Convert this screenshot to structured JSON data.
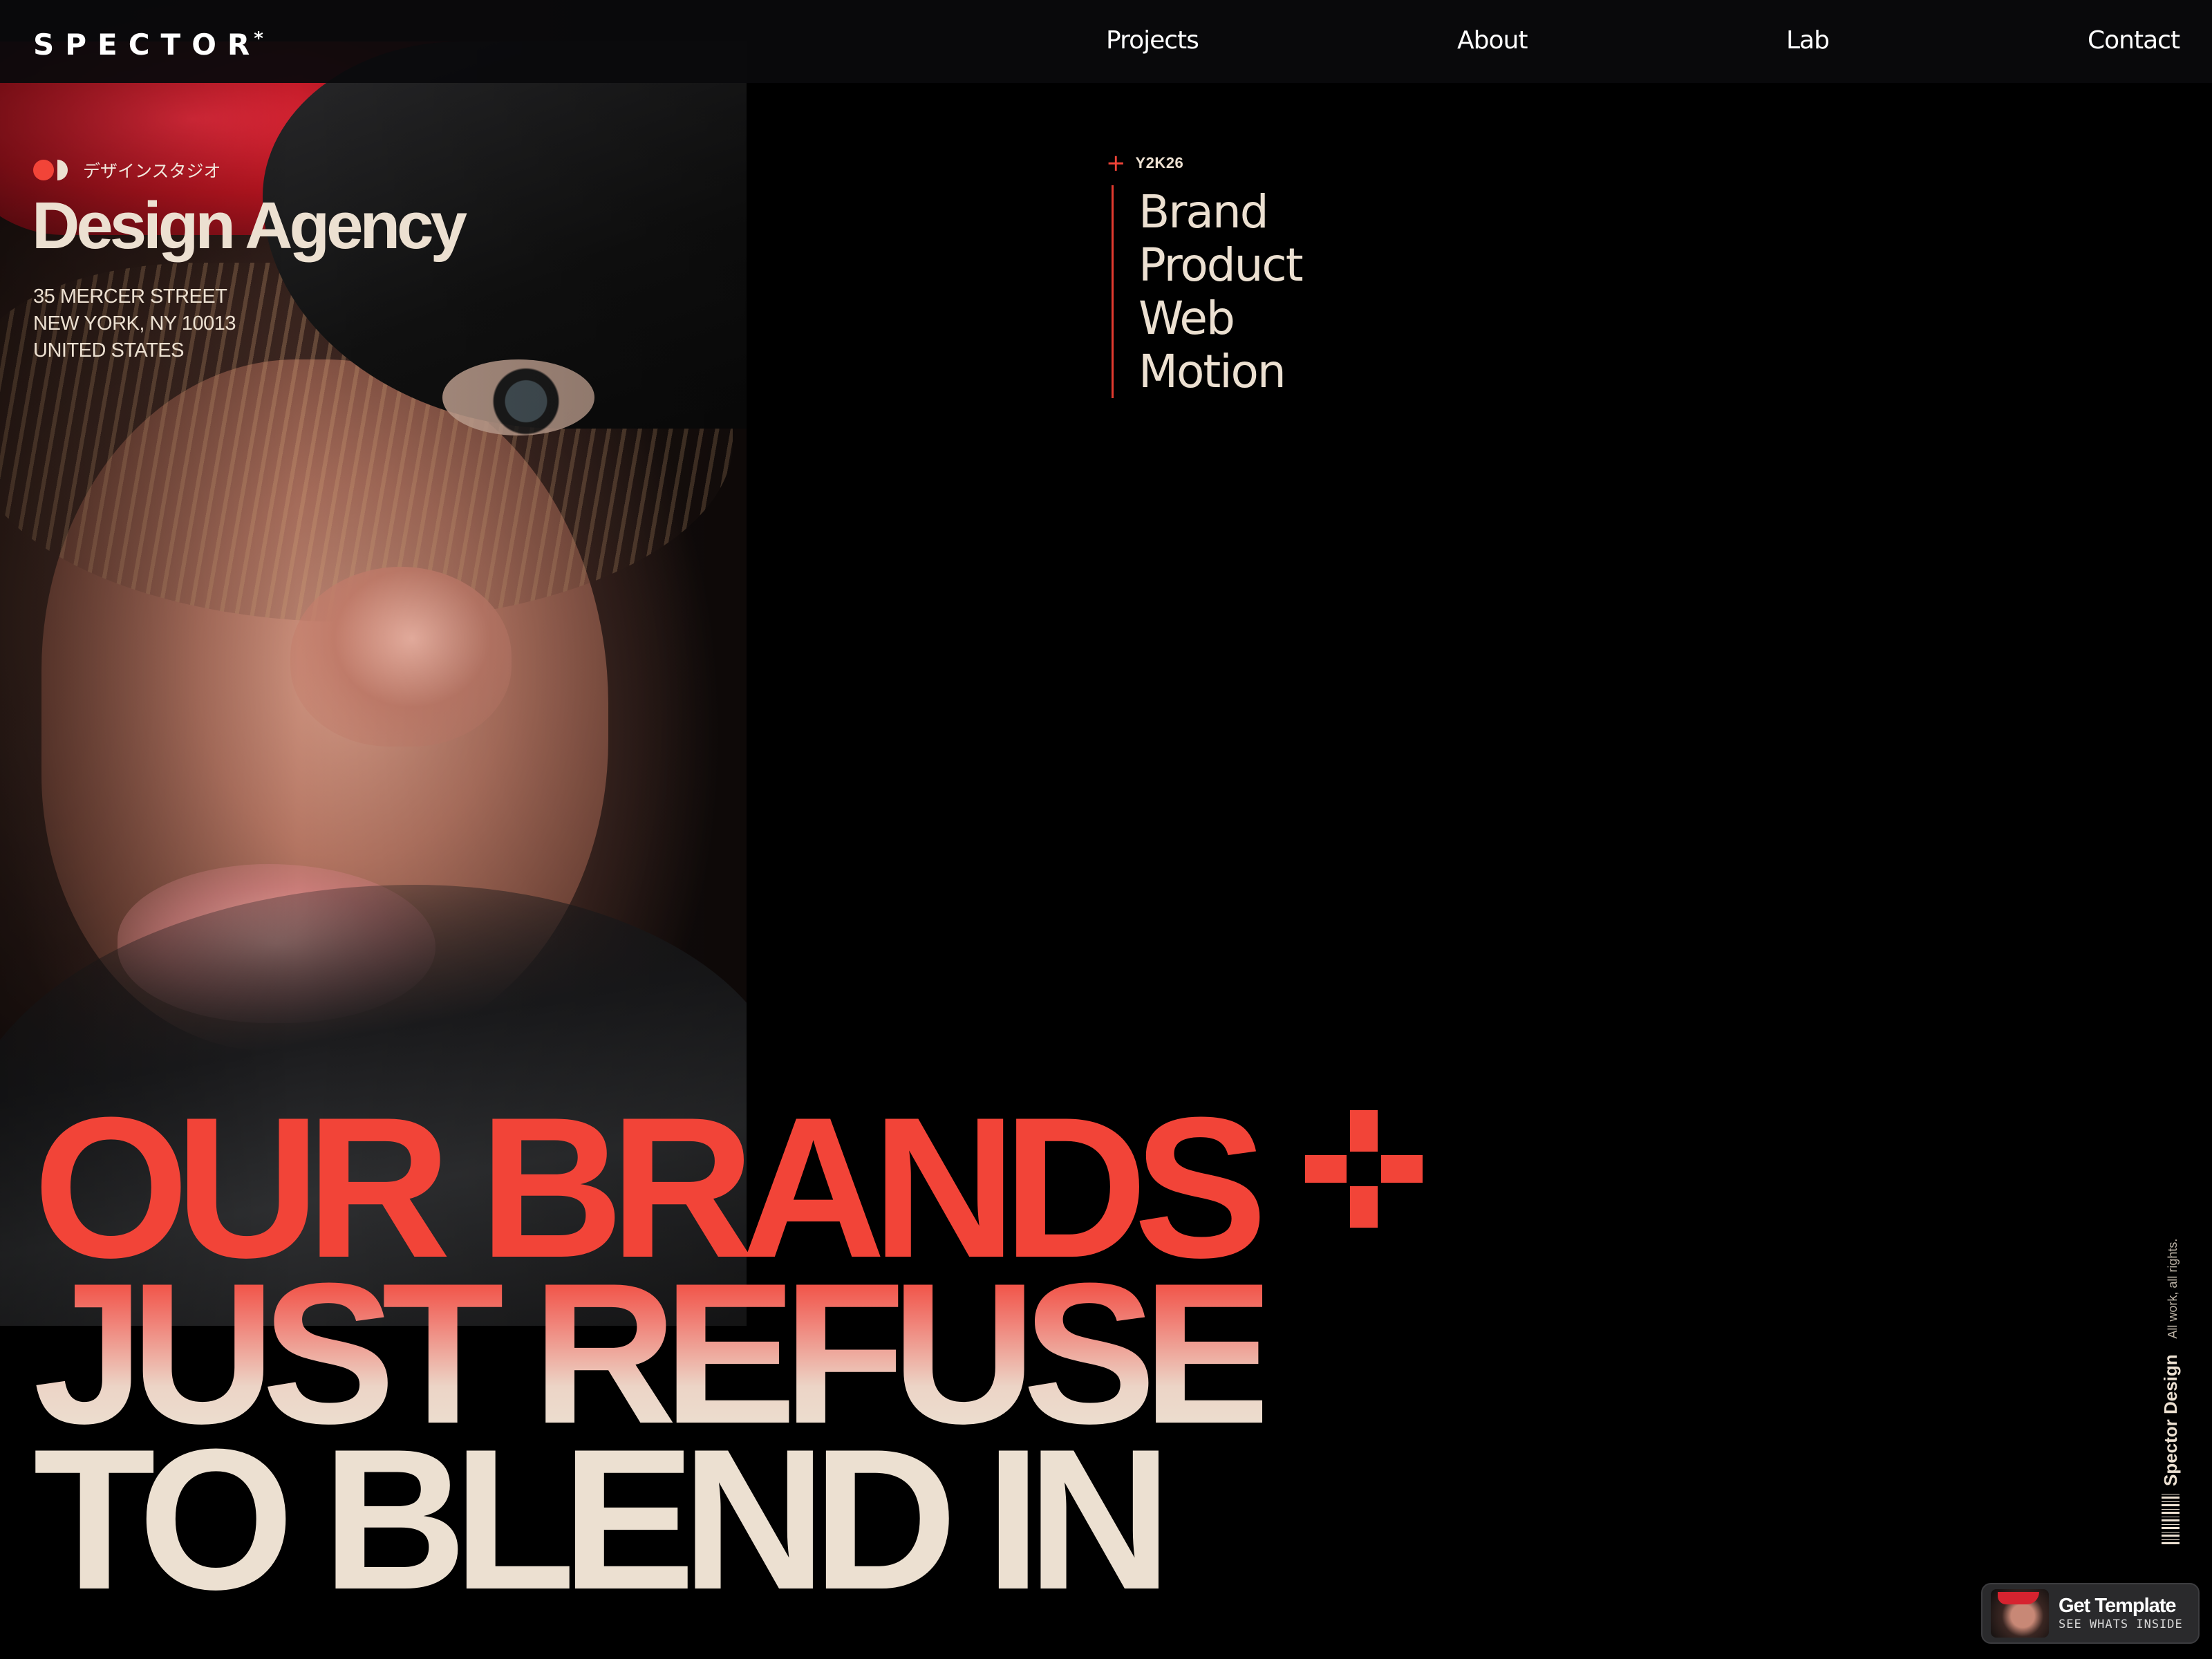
{
  "brand": {
    "logo_text": "SPECTOR",
    "logo_mark": "*"
  },
  "nav": {
    "items": [
      {
        "label": "Projects"
      },
      {
        "label": "About"
      },
      {
        "label": "Lab"
      },
      {
        "label": "Contact"
      }
    ]
  },
  "hero_image": {
    "description_icon": "portrait-photo"
  },
  "studio": {
    "subtitle_jp": "デザインスタジオ",
    "title": "Design Agency",
    "address": [
      "35 MERCER STREET",
      "NEW YORK, NY 10013",
      "UNITED STATES"
    ]
  },
  "services": {
    "year": "Y2K26",
    "items": [
      "Brand",
      "Product",
      "Web",
      "Motion"
    ]
  },
  "headline": {
    "line1": "OUR BRANDS",
    "line2": "JUST REFUSE",
    "line3": "TO BLEND IN"
  },
  "side_text": {
    "brand": "Spector Design",
    "rights": "All work, all rights."
  },
  "template_cta": {
    "title": "Get Template",
    "subtitle": "SEE WHATS INSIDE"
  },
  "colors": {
    "accent": "#f24438",
    "cream": "#ece0d1",
    "background": "#000000"
  }
}
